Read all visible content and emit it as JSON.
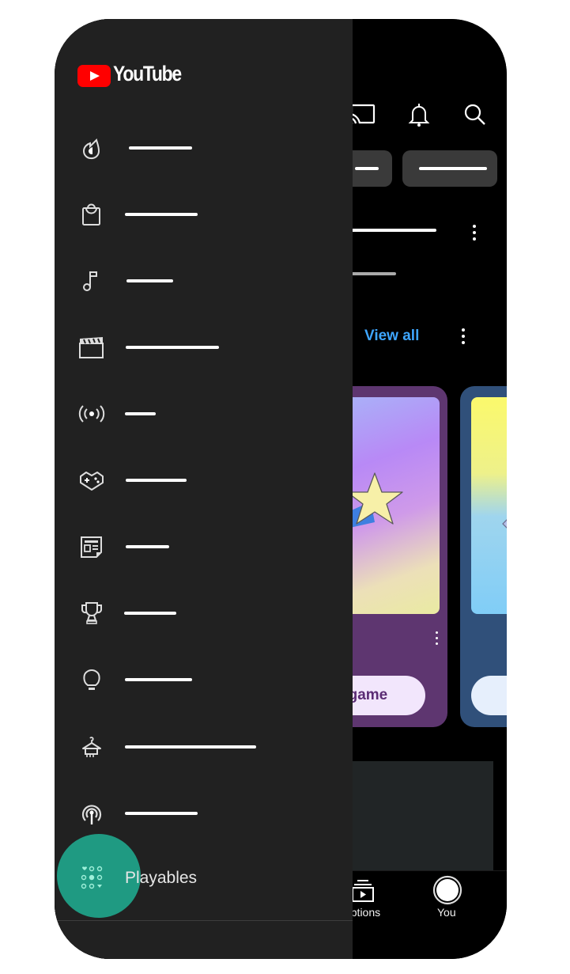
{
  "app": {
    "name": "YouTube",
    "brand_color": "#ff0000"
  },
  "header": {
    "icons": [
      "cast-icon",
      "notifications-icon",
      "search-icon"
    ]
  },
  "section": {
    "view_all_label": "View all",
    "accent_color": "#3ea6ff"
  },
  "cards": [
    {
      "button_label": "Play game",
      "button_visible_text": "t game",
      "theme_color": "#5e3670"
    },
    {
      "button_label": "",
      "theme_color": "#30507a"
    }
  ],
  "bottom_nav": {
    "items": [
      {
        "label": "Subscriptions",
        "visible_text": "criptions",
        "icon": "subscriptions-icon"
      },
      {
        "label": "You",
        "icon": "avatar-icon"
      }
    ]
  },
  "drawer": {
    "items": [
      {
        "icon": "trending-icon",
        "label": ""
      },
      {
        "icon": "shopping-icon",
        "label": ""
      },
      {
        "icon": "music-icon",
        "label": ""
      },
      {
        "icon": "movies-icon",
        "label": ""
      },
      {
        "icon": "live-icon",
        "label": ""
      },
      {
        "icon": "gaming-icon",
        "label": ""
      },
      {
        "icon": "news-icon",
        "label": ""
      },
      {
        "icon": "sports-icon",
        "label": ""
      },
      {
        "icon": "learning-icon",
        "label": ""
      },
      {
        "icon": "fashion-beauty-icon",
        "label": ""
      },
      {
        "icon": "podcasts-icon",
        "label": ""
      }
    ],
    "playables": {
      "label": "Playables",
      "icon": "playables-icon",
      "highlight_color": "#1f9a82"
    }
  }
}
